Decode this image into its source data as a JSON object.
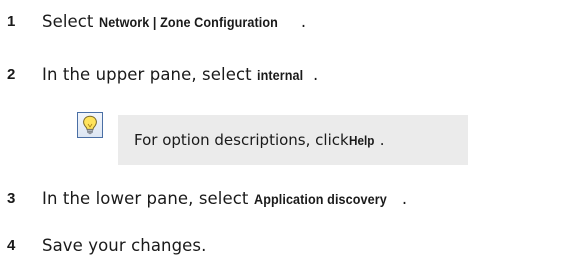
{
  "steps": [
    {
      "number": "1",
      "prefix": "Select ",
      "ui_term": "Network | Zone Configuration",
      "suffix": "."
    },
    {
      "number": "2",
      "prefix": "In the upper pane, select ",
      "ui_term": "internal",
      "suffix": "."
    },
    {
      "number": "3",
      "prefix": "In the lower pane, select ",
      "ui_term": "Application discovery",
      "suffix": "."
    },
    {
      "number": "4",
      "text": "Save your changes."
    }
  ],
  "tip": {
    "icon": "lightbulb-icon",
    "prefix": "For option descriptions, click ",
    "ui_term": "Help",
    "suffix": "."
  }
}
